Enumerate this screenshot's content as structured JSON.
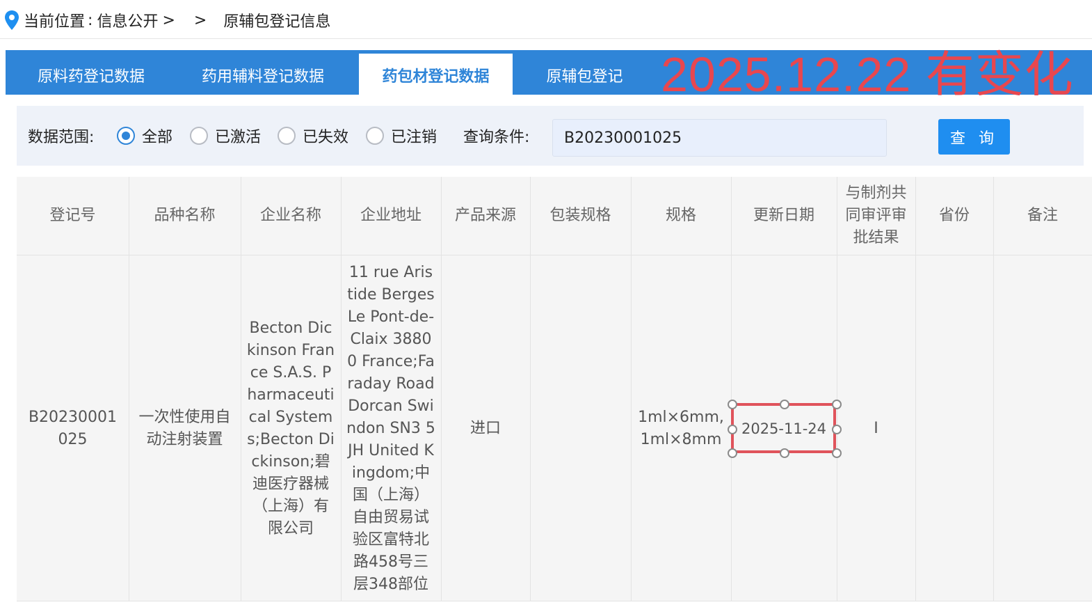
{
  "breadcrumb": {
    "prefix": "当前位置",
    "colon": ":",
    "section": "信息公开",
    "arrows": "> >",
    "current": "原辅包登记信息"
  },
  "tabs": [
    {
      "label": "原料药登记数据",
      "active": false
    },
    {
      "label": "药用辅料登记数据",
      "active": false
    },
    {
      "label": "药包材登记数据",
      "active": true
    },
    {
      "label": "原辅包登记",
      "active": false
    }
  ],
  "tab_note": "2025.12.22 有变化",
  "filter": {
    "range_label": "数据范围:",
    "options": [
      {
        "label": "全部",
        "selected": true
      },
      {
        "label": "已激活",
        "selected": false
      },
      {
        "label": "已失效",
        "selected": false
      },
      {
        "label": "已注销",
        "selected": false
      }
    ],
    "query_label": "查询条件:",
    "query_value": "B20230001025",
    "search_button": "查 询"
  },
  "table": {
    "headers": [
      "登记号",
      "品种名称",
      "企业名称",
      "企业地址",
      "产品来源",
      "包装规格",
      "规格",
      "更新日期",
      "与制剂共同审评审批结果",
      "省份",
      "备注"
    ],
    "row": {
      "reg_no": "B20230001025",
      "product_name": "一次性使用自动注射装置",
      "company_name": "Becton Dickinson France S.A.S. Pharmaceutical Systems;Becton Dickinson;碧迪医疗器械（上海）有限公司",
      "company_address": "11 rue Aristide Berges Le Pont-de-Claix 38800 France;Faraday Road Dorcan Swindon SN3 5JH United Kingdom;中国（上海）自由贸易试验区富特北路458号三层348部位",
      "source": "进口",
      "package_spec": "",
      "spec_line1": "1ml×6mm,",
      "spec_line2": "1ml×8mm",
      "update_date": "2025-11-24",
      "review_result": "I",
      "province": "",
      "remark": ""
    }
  },
  "colors": {
    "accent": "#2f85d8",
    "button": "#1f8ef0",
    "annotation": "#e0535b",
    "filter_bg": "#eef2f9",
    "table_bg": "#f5f5f5"
  }
}
